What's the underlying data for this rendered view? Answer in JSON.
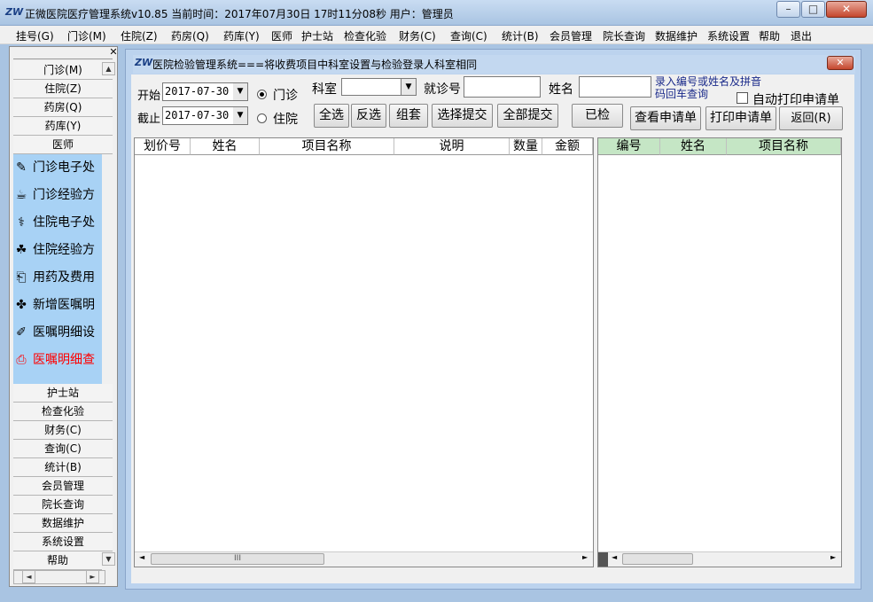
{
  "titlebar": {
    "title": "正微医院医疗管理系统v10.85   当前时间：2017年07月30日  17时11分08秒   用户：管理员",
    "icon": "zw-logo-icon",
    "minimize": "–",
    "maximize": "□",
    "close": "✕"
  },
  "menu": [
    {
      "label": "挂号(G)"
    },
    {
      "label": "门诊(M)"
    },
    {
      "label": "住院(Z)"
    },
    {
      "label": "药房(Q)"
    },
    {
      "label": "药库(Y)"
    },
    {
      "label": "医师"
    },
    {
      "label": "护士站"
    },
    {
      "label": "检查化验"
    },
    {
      "label": "财务(C)"
    },
    {
      "label": "查询(C)"
    },
    {
      "label": "统计(B)"
    },
    {
      "label": "会员管理"
    },
    {
      "label": "院长查询"
    },
    {
      "label": "数据维护"
    },
    {
      "label": "系统设置"
    },
    {
      "label": "帮助"
    },
    {
      "label": "退出"
    }
  ],
  "sidebar": {
    "close": "✕",
    "top_items": [
      {
        "label": "门诊(M)"
      },
      {
        "label": "住院(Z)"
      },
      {
        "label": "药房(Q)"
      },
      {
        "label": "药库(Y)"
      },
      {
        "label": "医师"
      }
    ],
    "links": [
      {
        "label": "门诊电子处",
        "icon": "pen-icon",
        "glyph": "✎"
      },
      {
        "label": "门诊经验方",
        "icon": "pill-icon",
        "glyph": "☕"
      },
      {
        "label": "住院电子处",
        "icon": "doctor-icon",
        "glyph": "⚕"
      },
      {
        "label": "住院经验方",
        "icon": "mortar-icon",
        "glyph": "☘"
      },
      {
        "label": "用药及费用",
        "icon": "document-icon",
        "glyph": "⎗"
      },
      {
        "label": "新增医嘱明",
        "icon": "add-order-icon",
        "glyph": "✤"
      },
      {
        "label": "医嘱明细设",
        "icon": "edit-icon",
        "glyph": "✐"
      },
      {
        "label": "医嘱明细查",
        "icon": "search-doc-icon",
        "glyph": "⎙",
        "highlight": true
      }
    ],
    "bottom_items": [
      {
        "label": "护士站"
      },
      {
        "label": "检查化验"
      },
      {
        "label": "财务(C)"
      },
      {
        "label": "查询(C)"
      },
      {
        "label": "统计(B)"
      },
      {
        "label": "会员管理"
      },
      {
        "label": "院长查询"
      },
      {
        "label": "数据维护"
      },
      {
        "label": "系统设置"
      },
      {
        "label": "帮助"
      }
    ]
  },
  "window": {
    "title": "医院检验管理系统===将收费项目中科室设置与检验登录人科室相同",
    "close": "✕"
  },
  "filter": {
    "start_label": "开始",
    "start_date": "2017-07-30",
    "end_label": "截止",
    "end_date": "2017-07-30",
    "radio_outpatient": "门诊",
    "radio_inpatient": "住院",
    "dept_label": "科室",
    "dept_value": "",
    "visit_label": "就诊号",
    "visit_value": "",
    "name_label": "姓名",
    "name_value": "",
    "hint": "录入编号或姓名及拼音码回车查询",
    "auto_print_label": "自动打印申请单"
  },
  "buttons": {
    "select_all": "全选",
    "invert": "反选",
    "group": "组套",
    "submit_selected": "选择提交",
    "submit_all": "全部提交",
    "checked": "已检",
    "view_request": "查看申请单",
    "print_request": "打印申请单",
    "back": "返回(R)"
  },
  "left_grid": {
    "columns": [
      "划价号",
      "姓名",
      "项目名称",
      "说明",
      "数量",
      "金额"
    ],
    "rows": []
  },
  "right_grid": {
    "columns": [
      "编号",
      "姓名",
      "项目名称"
    ],
    "rows": []
  },
  "colors": {
    "title_bg": "#a9c4e2",
    "sidebar_link_bg": "#a8d2f5",
    "highlight_link": "#ff0000",
    "right_header_bg": "#c5e6c5"
  }
}
